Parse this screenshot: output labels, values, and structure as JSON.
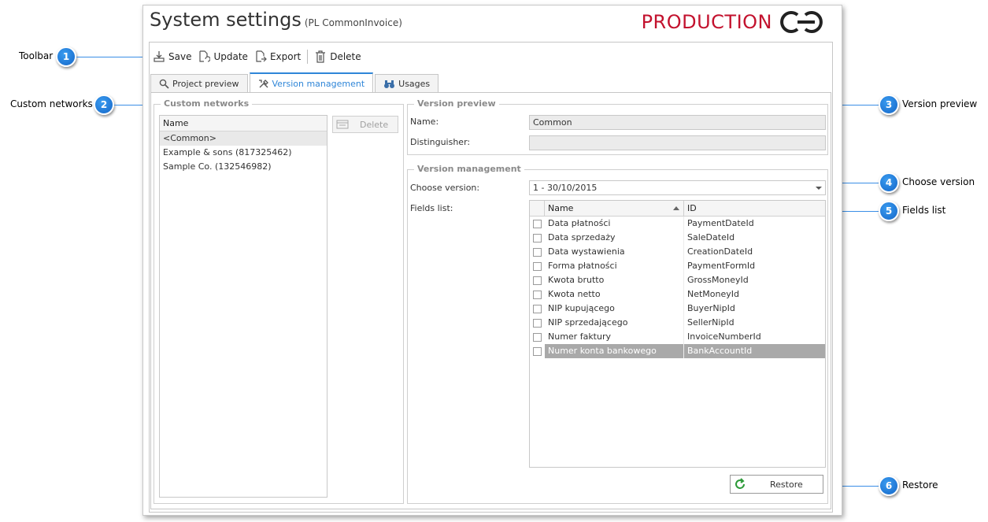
{
  "window": {
    "title": "System settings",
    "subtitle": "(PL CommonInvoice)",
    "environment": "PRODUCTION",
    "brand_color": "#c3122e"
  },
  "toolbar": {
    "save": "Save",
    "update": "Update",
    "export": "Export",
    "delete": "Delete"
  },
  "tabs": [
    {
      "label": "Project preview",
      "icon": "magnifier-icon"
    },
    {
      "label": "Version management",
      "icon": "tools-icon",
      "active": true
    },
    {
      "label": "Usages",
      "icon": "binoculars-icon"
    }
  ],
  "custom_networks": {
    "title": "Custom networks",
    "column": "Name",
    "items": [
      "<Common>",
      "Example & sons (817325462)",
      "Sample Co. (132546982)"
    ],
    "selected_index": 0,
    "delete_label": "Delete"
  },
  "version_preview": {
    "title": "Version preview",
    "name_label": "Name:",
    "name_value": "Common",
    "distinguisher_label": "Distinguisher:",
    "distinguisher_value": ""
  },
  "version_management": {
    "title": "Version management",
    "choose_label": "Choose version:",
    "choose_value": "1 - 30/10/2015",
    "fields_label": "Fields list:",
    "columns": {
      "name": "Name",
      "id": "ID"
    },
    "rows": [
      {
        "name": "Data płatności",
        "id": "PaymentDateId"
      },
      {
        "name": "Data sprzedaży",
        "id": "SaleDateId"
      },
      {
        "name": "Data wystawienia",
        "id": "CreationDateId"
      },
      {
        "name": "Forma płatności",
        "id": "PaymentFormId"
      },
      {
        "name": "Kwota brutto",
        "id": "GrossMoneyId"
      },
      {
        "name": "Kwota netto",
        "id": "NetMoneyId"
      },
      {
        "name": "NIP kupującego",
        "id": "BuyerNipId"
      },
      {
        "name": "NIP sprzedającego",
        "id": "SellerNipId"
      },
      {
        "name": "Numer faktury",
        "id": "InvoiceNumberId"
      },
      {
        "name": "Numer konta bankowego",
        "id": "BankAccountId"
      }
    ],
    "selected_row": 9,
    "restore_label": "Restore"
  },
  "callouts": [
    {
      "number": "1",
      "label": "Toolbar"
    },
    {
      "number": "2",
      "label": "Custom networks"
    },
    {
      "number": "3",
      "label": "Version preview"
    },
    {
      "number": "4",
      "label": "Choose version"
    },
    {
      "number": "5",
      "label": "Fields list"
    },
    {
      "number": "6",
      "label": "Restore"
    }
  ],
  "colors": {
    "accent": "#2f86d8",
    "callout": "#1a73d6"
  }
}
